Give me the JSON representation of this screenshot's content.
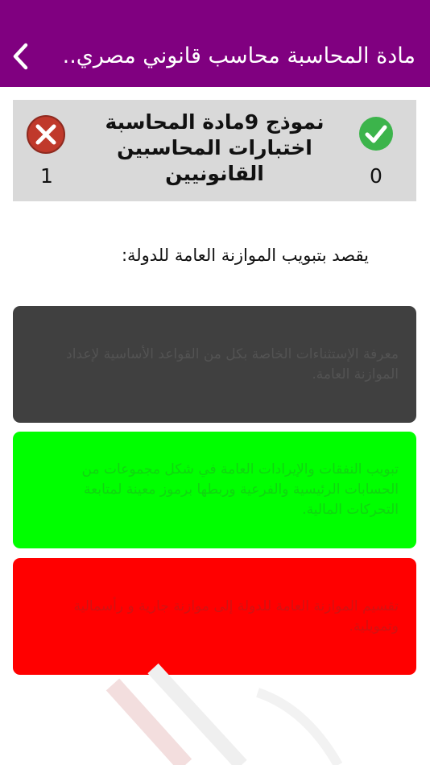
{
  "header": {
    "title": "مادة المحاسبة محاسب قانوني مصري...",
    "back_icon": "chevron-left-icon"
  },
  "score": {
    "test_title": "نموذج 9مادة المحاسبة اختبارات المحاسبين القانونيين",
    "correct_count": "0",
    "wrong_count": "1",
    "correct_icon": "check-circle-icon",
    "wrong_icon": "x-circle-icon"
  },
  "question": {
    "text": "يقصد بتبويب الموازنة العامة للدولة:"
  },
  "answers": [
    {
      "text": "معرفة الإستثناءات الخاصة بكل من القواعد الأساسية لإعداد الموازنة العامة.",
      "color": "#404040"
    },
    {
      "text": "تبويب النفقات والإيرادات العامة في شكل مجموعات من الحسابات الرئيسية والفرعية وربطها برموز معينة لمتابعة التحركات المالية.",
      "color": "#00ff00"
    },
    {
      "text": "تقسيم الموازنة العامة للدولة إلى موازنة جارية و رأسمالية وتمويلية.",
      "color": "#ff0000"
    }
  ],
  "colors": {
    "header_bg": "#800080",
    "score_bg": "#d9d9d9",
    "correct": "#3cb44b",
    "wrong": "#c0392b"
  }
}
